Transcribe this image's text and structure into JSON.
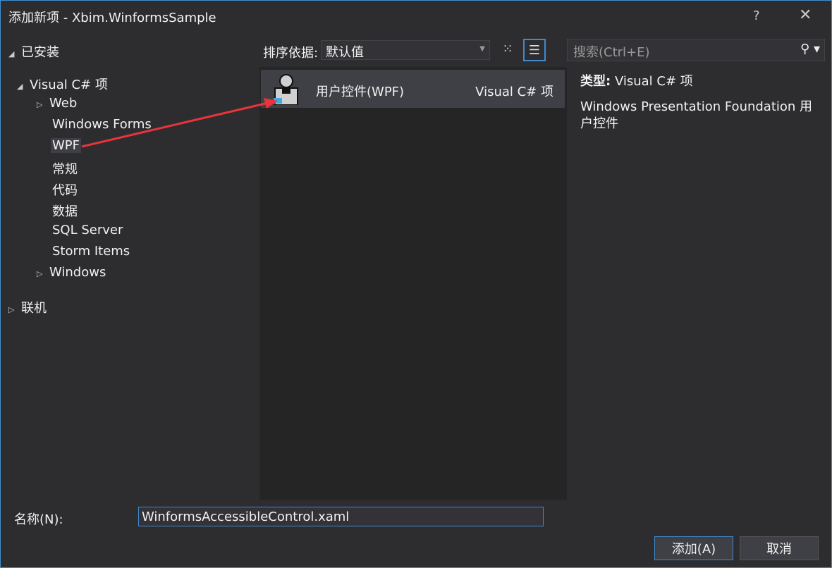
{
  "window": {
    "title": "添加新项 - Xbim.WinformsSample",
    "help": "?",
    "close": "✕"
  },
  "tree": {
    "installed": "已安装",
    "csharp": "Visual C# 项",
    "children": [
      "Web",
      "Windows Forms",
      "WPF",
      "常规",
      "代码",
      "数据",
      "SQL Server",
      "Storm Items",
      "Windows"
    ],
    "online": "联机"
  },
  "toolbar": {
    "sort_label": "排序依据:",
    "sort_value": "默认值",
    "search_placeholder": "搜索(Ctrl+E)"
  },
  "list": {
    "items": [
      {
        "name": "用户控件(WPF)",
        "lang": "Visual C# 项"
      }
    ]
  },
  "detail": {
    "type_label": "类型:",
    "type_value": "Visual C# 项",
    "description": "Windows Presentation Foundation 用户控件"
  },
  "footer": {
    "name_label": "名称(N):",
    "name_value": "WinformsAccessibleControl.xaml",
    "add": "添加(A)",
    "cancel": "取消"
  },
  "colors": {
    "accent": "#3e8ad0",
    "arrow": "#e8343a"
  }
}
